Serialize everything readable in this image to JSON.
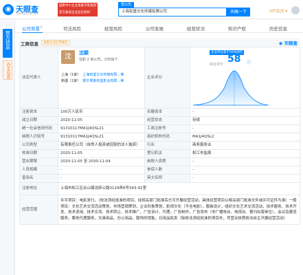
{
  "header": {
    "logo_text": "天眼查",
    "logo_sub": "TianYanCha.com",
    "notice_lines": [
      "国家中小企业发展子基金旗下",
      "官方备案企业征信机构"
    ],
    "search_tab": "查公司",
    "search_value": "上海有堡文化传媒有限公司",
    "search_button": "天眼一下",
    "vip_label": "VIP会员",
    "vip_caret": "▾"
  },
  "left_rail": {
    "official_label": "官方信息",
    "self_label": "自主信息"
  },
  "tabs": [
    {
      "label": "公司背景",
      "count": "6",
      "active": true
    },
    {
      "label": "司法风险",
      "count": "",
      "active": false
    },
    {
      "label": "经营风险",
      "count": "",
      "active": false
    },
    {
      "label": "公司发展",
      "count": "",
      "active": false
    },
    {
      "label": "经营状况",
      "count": "",
      "active": false
    },
    {
      "label": "知识产权",
      "count": "",
      "active": false
    },
    {
      "label": "历史信息",
      "count": "",
      "active": false
    }
  ],
  "section": {
    "title": "工商信息",
    "badge": "查看企业信用报告",
    "brand": "天眼查"
  },
  "rep": {
    "label": "法定代表人",
    "avatar_char": "沈",
    "name": "沈颖",
    "meta": "任职 2 家公司，分布如下",
    "list": [
      {
        "region": "上海（1家）",
        "company": "上海有堡文化传媒有限…等"
      },
      {
        "region": "新疆（1家）",
        "company": "霍尔果斯有堡影业有限…等"
      }
    ]
  },
  "score": {
    "label": "企业评分",
    "badge": "企业评分高于50%同行",
    "sub": "综合评分",
    "value": "58"
  },
  "rows": [
    [
      {
        "l": "注册资本",
        "v": "100万人民币"
      },
      {
        "l": "实缴资本",
        "v": "-"
      }
    ],
    [
      {
        "l": "成立日期",
        "v": "2020-11-05"
      },
      {
        "l": "经营状态",
        "v": "存续"
      }
    ],
    [
      {
        "l": "统一社会信用代码",
        "v": "91310117MA1J4QSL21"
      },
      {
        "l": "工商注册号",
        "v": "-"
      }
    ],
    [
      {
        "l": "纳税人识别号",
        "v": "91310117MA1J4QSL21"
      },
      {
        "l": "组织机构代码",
        "v": "MA1J4QSL2"
      }
    ],
    [
      {
        "l": "公司类型",
        "v": "有限责任公司（自然人投资或控股的法人独资）"
      },
      {
        "l": "行业",
        "v": "商务服务业"
      }
    ],
    [
      {
        "l": "核准日期",
        "v": "2020-11-05"
      },
      {
        "l": "登记机关",
        "v": "松江市监局"
      }
    ],
    [
      {
        "l": "营业期限",
        "v": "2020-11-05 至 2030-11-04"
      },
      {
        "l": "纳税人资质",
        "v": "-"
      }
    ],
    [
      {
        "l": "人员规模",
        "v": "-"
      },
      {
        "l": "参保人数",
        "v": "-"
      }
    ],
    [
      {
        "l": "曾用名",
        "v": "-"
      },
      {
        "l": "英文名称",
        "v": "-"
      }
    ]
  ],
  "address": {
    "label": "注册地址",
    "value": "上海市松江区佘山镇沈砖公路3129弄8号343-91室"
  },
  "scope": {
    "label": "经营范围",
    "value": "许可项目：电影发行。（依法须经批准的项目，经相关部门批准后方可开展经营活动，具体经营项目以相关部门批准文件或许可证件为准）一般项目：文化艺术交流活动策划，市场营销策划，企业形象策划，影视文化（不含电影），服装设计，组织文化艺术交流活动，技术服务、技术开发、技术咨询、技术交流、技术转让、技术推广，广告设计、代理，广告制作，广告发布（非广播电台、电视台、报刊出版单位），会议及展览服务，票务代理服务，文具用品、办公用品、服饰的销售，日用品批发（除依法须经批准的项目外，凭营业执照依法自主开展经营活动）"
  }
}
